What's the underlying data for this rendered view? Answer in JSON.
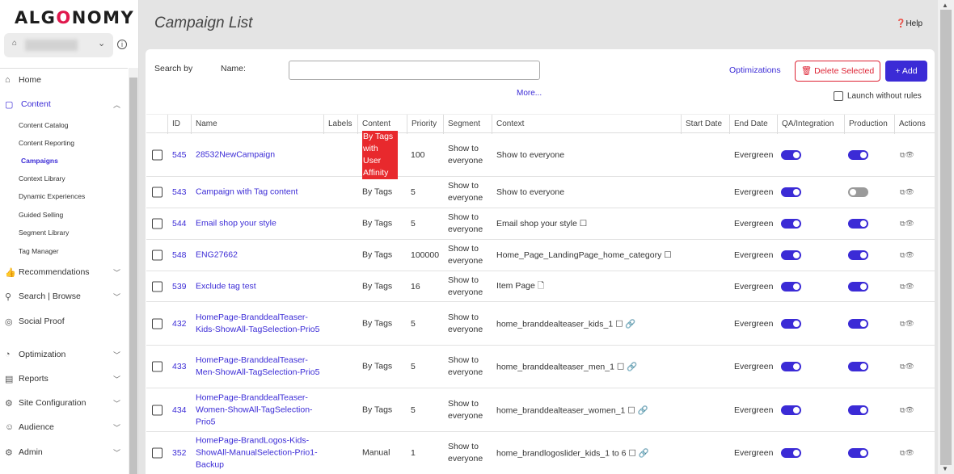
{
  "brand": {
    "logo_left": "ALG",
    "logo_o": "O",
    "logo_right": "NOMY"
  },
  "sidebar": {
    "items": [
      {
        "label": "Home",
        "icon": "home-icon"
      },
      {
        "label": "Content",
        "icon": "clipboard-icon",
        "expanded": true
      },
      {
        "label": "Recommendations",
        "icon": "thumbs-up-icon"
      },
      {
        "label": "Search | Browse",
        "icon": "search-icon"
      },
      {
        "label": "Social Proof",
        "icon": "social-icon"
      },
      {
        "label": "Optimization",
        "icon": "gauge-icon"
      },
      {
        "label": "Reports",
        "icon": "reports-icon"
      },
      {
        "label": "Site Configuration",
        "icon": "config-icon"
      },
      {
        "label": "Audience",
        "icon": "audience-icon"
      },
      {
        "label": "Admin",
        "icon": "admin-icon"
      }
    ],
    "content_subitems": [
      "Content Catalog",
      "Content Reporting",
      "Campaigns",
      "Context Library",
      "Dynamic Experiences",
      "Guided Selling",
      "Segment Library",
      "Tag Manager"
    ],
    "active_subitem": "Campaigns"
  },
  "page": {
    "title": "Campaign List",
    "help": "Help"
  },
  "search": {
    "search_by": "Search by",
    "name_label": "Name:",
    "name_value": "",
    "more": "More..."
  },
  "actions": {
    "optimizations": "Optimizations",
    "delete_selected": "Delete Selected",
    "add": "Add",
    "launch_without_rules": "Launch without rules"
  },
  "table": {
    "columns": [
      "ID",
      "Name",
      "Labels",
      "Content",
      "Priority",
      "Segment",
      "Context",
      "Start Date",
      "End Date",
      "QA/Integration",
      "Production",
      "Actions"
    ],
    "rows": [
      {
        "id": "545",
        "name": "28532NewCampaign",
        "content": "By Tags with User Affinity",
        "priority": "100",
        "segment": "Show to everyone",
        "context": "Show to everyone",
        "end_date": "Evergreen",
        "qa": true,
        "production": true
      },
      {
        "id": "543",
        "name": "Campaign with Tag content",
        "content": "By Tags",
        "priority": "5",
        "segment": "Show to everyone",
        "context": "Show to everyone",
        "end_date": "Evergreen",
        "qa": true,
        "production": false
      },
      {
        "id": "544",
        "name": "Email shop your style",
        "content": "By Tags",
        "priority": "5",
        "segment": "Show to everyone",
        "context": "Email shop your style ☐",
        "end_date": "Evergreen",
        "qa": true,
        "production": true
      },
      {
        "id": "548",
        "name": "ENG27662",
        "content": "By Tags",
        "priority": "100000",
        "segment": "Show to everyone",
        "context": "Home_Page_LandingPage_home_category ☐",
        "end_date": "Evergreen",
        "qa": true,
        "production": true
      },
      {
        "id": "539",
        "name": "Exclude tag test",
        "content": "By Tags",
        "priority": "16",
        "segment": "Show to everyone",
        "context": "Item Page 🗋",
        "end_date": "Evergreen",
        "qa": true,
        "production": true
      },
      {
        "id": "432",
        "name": "HomePage-BranddealTeaser-Kids-ShowAll-TagSelection-Prio5",
        "content": "By Tags",
        "priority": "5",
        "segment": "Show to everyone",
        "context": "home_branddealteaser_kids_1 ☐ 🔗",
        "end_date": "Evergreen",
        "qa": true,
        "production": true
      },
      {
        "id": "433",
        "name": "HomePage-BranddealTeaser-Men-ShowAll-TagSelection-Prio5",
        "content": "By Tags",
        "priority": "5",
        "segment": "Show to everyone",
        "context": "home_branddealteaser_men_1 ☐ 🔗",
        "end_date": "Evergreen",
        "qa": true,
        "production": true
      },
      {
        "id": "434",
        "name": "HomePage-BranddealTeaser-Women-ShowAll-TagSelection-Prio5",
        "content": "By Tags",
        "priority": "5",
        "segment": "Show to everyone",
        "context": "home_branddealteaser_women_1 ☐ 🔗",
        "end_date": "Evergreen",
        "qa": true,
        "production": true
      },
      {
        "id": "352",
        "name": "HomePage-BrandLogos-Kids-ShowAll-ManualSelection-Prio1-Backup",
        "content": "Manual",
        "priority": "1",
        "segment": "Show to everyone",
        "context": "home_brandlogoslider_kids_1 to 6 ☐ 🔗",
        "end_date": "Evergreen",
        "qa": true,
        "production": true
      }
    ]
  },
  "colors": {
    "accent": "#3b2bd6",
    "danger": "#dd2233",
    "highlight": "#e8292d"
  }
}
